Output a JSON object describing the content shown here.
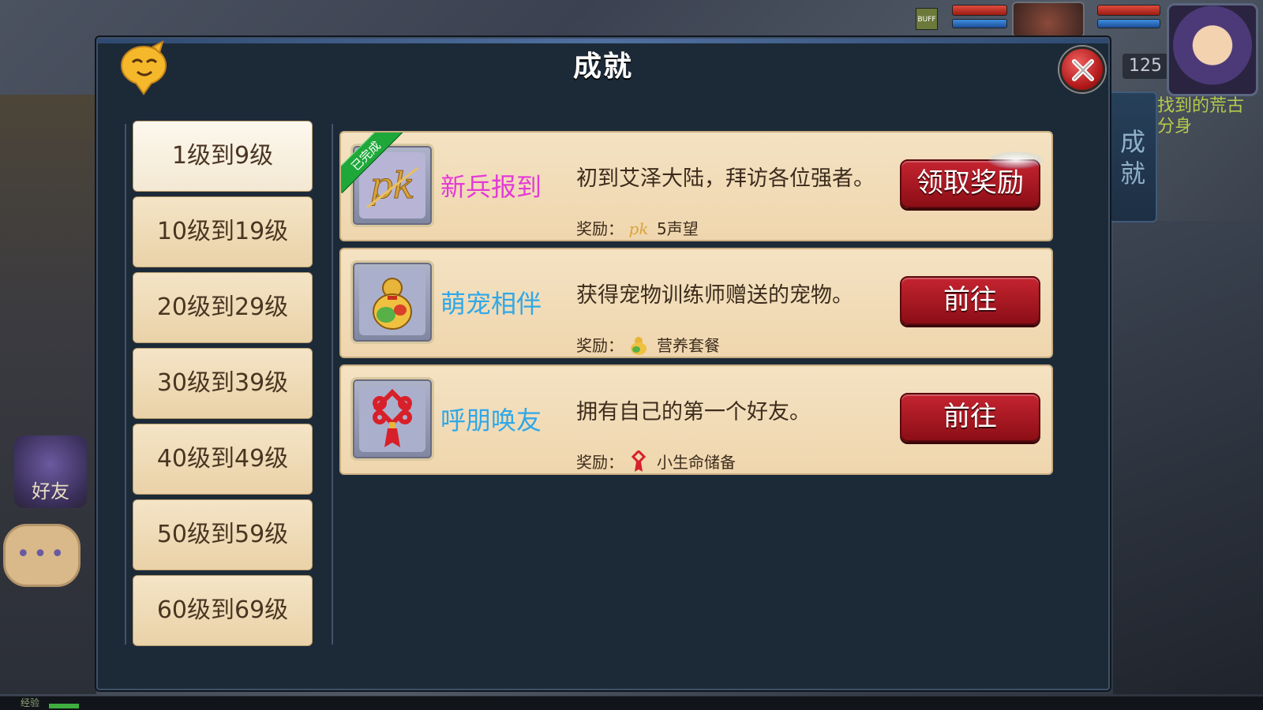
{
  "hud": {
    "level": "125",
    "side_tab": "成就",
    "quest_line1": "找到的荒古",
    "quest_line2": "分身",
    "small_icon_label": "BUFF"
  },
  "friend_button": {
    "label": "好友"
  },
  "chat_button": {
    "label": "•••"
  },
  "exp_bar": {
    "label": "经验",
    "progress": 0.024
  },
  "modal": {
    "title": "成就",
    "close_icon": "close-icon",
    "mascot_icon": "mascot-icon"
  },
  "level_tabs": [
    {
      "label": "1级到9级",
      "active": true
    },
    {
      "label": "10级到19级",
      "active": false
    },
    {
      "label": "20级到29级",
      "active": false
    },
    {
      "label": "30级到39级",
      "active": false
    },
    {
      "label": "40级到49级",
      "active": false
    },
    {
      "label": "50级到59级",
      "active": false
    },
    {
      "label": "60级到69级",
      "active": false
    }
  ],
  "achievements": [
    {
      "name": "新兵报到",
      "name_color": "#e43ad8",
      "description": "初到艾泽大陆，拜访各位强者。",
      "reward_prefix": "奖励：",
      "reward": "5声望",
      "reward_icon": "pk-icon",
      "button": "领取奖励",
      "completed_badge": "已完成",
      "icon": "pk-badge-icon"
    },
    {
      "name": "萌宠相伴",
      "name_color": "#2fa8e8",
      "description": "获得宠物训练师赠送的宠物。",
      "reward_prefix": "奖励：",
      "reward": "营养套餐",
      "reward_icon": "gourd-icon",
      "button": "前往",
      "icon": "gourd-icon"
    },
    {
      "name": "呼朋唤友",
      "name_color": "#2fa8e8",
      "description": "拥有自己的第一个好友。",
      "reward_prefix": "奖励：",
      "reward": "小生命储备",
      "reward_icon": "chinese-knot-icon",
      "button": "前往",
      "icon": "chinese-knot-icon"
    }
  ]
}
